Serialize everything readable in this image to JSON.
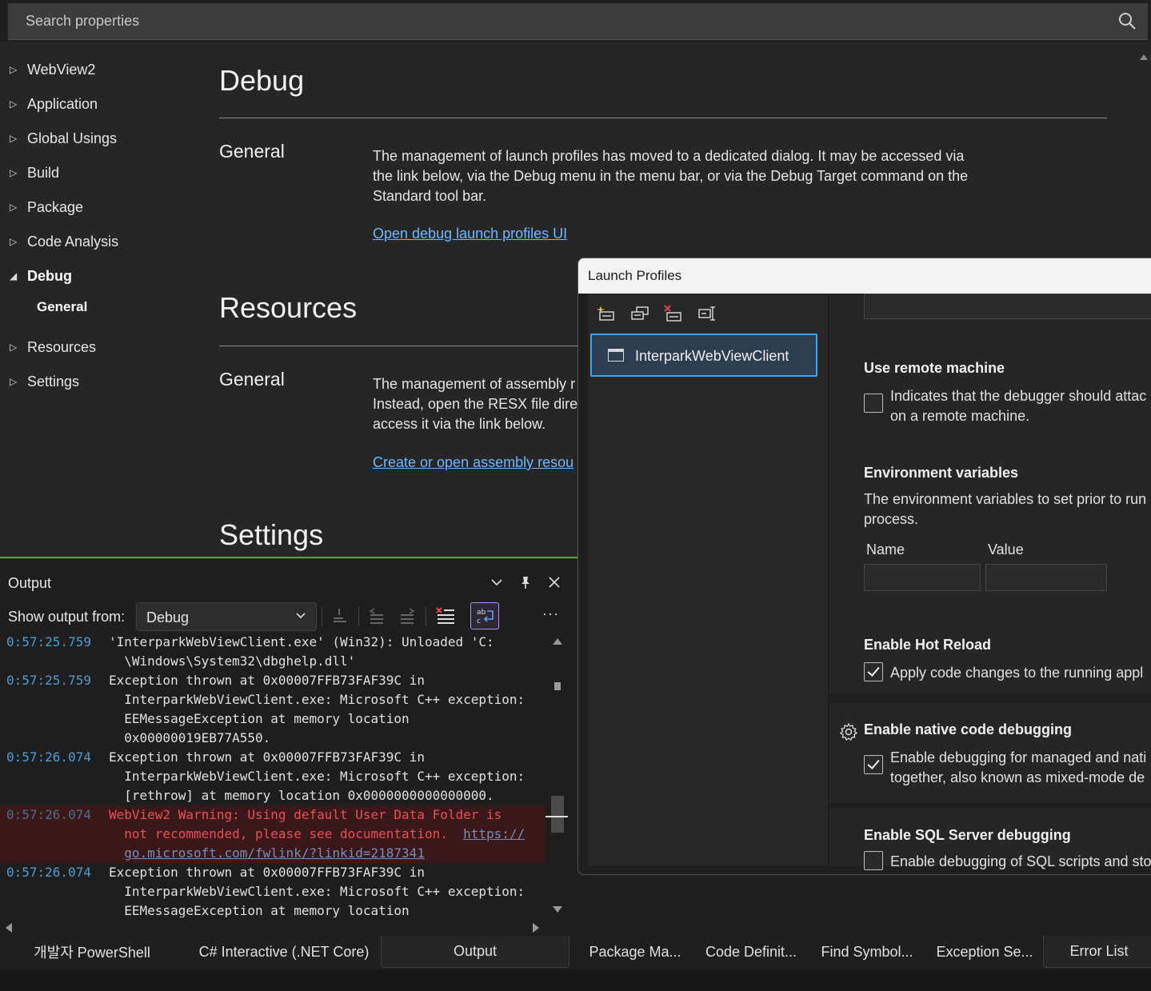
{
  "search": {
    "placeholder": "Search properties"
  },
  "nav": {
    "items": [
      {
        "label": "WebView2",
        "expanded": false
      },
      {
        "label": "Application",
        "expanded": false
      },
      {
        "label": "Global Usings",
        "expanded": false
      },
      {
        "label": "Build",
        "expanded": false
      },
      {
        "label": "Package",
        "expanded": false
      },
      {
        "label": "Code Analysis",
        "expanded": false
      },
      {
        "label": "Debug",
        "expanded": true
      },
      {
        "label": "Resources",
        "expanded": false
      },
      {
        "label": "Settings",
        "expanded": false
      }
    ],
    "debug_sub": "General"
  },
  "content": {
    "debug_title": "Debug",
    "debug_general": "General",
    "debug_desc": "The management of launch profiles has moved to a dedicated dialog. It may be accessed via the link below, via the Debug menu in the menu bar, or via the Debug Target command on the Standard tool bar.",
    "debug_link": "Open debug launch profiles UI",
    "resources_title": "Resources",
    "resources_general": "General",
    "resources_desc_lines": [
      "The management of assembly r",
      "Instead, open the RESX file dire",
      "access it via the link below."
    ],
    "resources_link": "Create or open assembly resou",
    "settings_title": "Settings"
  },
  "output": {
    "title": "Output",
    "show_label": "Show output from:",
    "source": "Debug",
    "more": "···",
    "entries": [
      {
        "ts": "0:57:25.759",
        "lines": [
          "'InterparkWebViewClient.exe' (Win32): Unloaded 'C:",
          "  \\Windows\\System32\\dbghelp.dll'"
        ],
        "warn": false
      },
      {
        "ts": "0:57:25.759",
        "lines": [
          "Exception thrown at 0x00007FFB73FAF39C in",
          "  InterparkWebViewClient.exe: Microsoft C++ exception:",
          "  EEMessageException at memory location",
          "  0x00000019EB77A550."
        ],
        "warn": false
      },
      {
        "ts": "0:57:26.074",
        "lines": [
          "Exception thrown at 0x00007FFB73FAF39C in",
          "  InterparkWebViewClient.exe: Microsoft C++ exception:",
          "  [rethrow] at memory location 0x0000000000000000."
        ],
        "warn": false
      },
      {
        "ts": "0:57:26.074",
        "lines": [
          "WebView2 Warning: Using default User Data Folder is",
          "  not recommended, please see documentation.  "
        ],
        "link1": "https://",
        "link2": "go.microsoft.com/fwlink/?linkid=2187341",
        "warn": true
      },
      {
        "ts": "0:57:26.074",
        "lines": [
          "Exception thrown at 0x00007FFB73FAF39C in",
          "  InterparkWebViewClient.exe: Microsoft C++ exception:",
          "  EEMessageException at memory location"
        ],
        "warn": false
      }
    ]
  },
  "bottom_tabs_left": [
    "개발자 PowerShell",
    "C# Interactive (.NET Core)",
    "Output"
  ],
  "bottom_tabs_left_active": "Output",
  "bottom_tabs_right": [
    "Package Ma...",
    "Code Definit...",
    "Find Symbol...",
    "Exception Se...",
    "Error List"
  ],
  "dialog": {
    "title": "Launch Profiles",
    "profile": "InterparkWebViewClient",
    "remote": {
      "title": "Use remote machine",
      "text_lines": [
        "Indicates that the debugger should attac",
        "on a remote machine."
      ],
      "checked": false
    },
    "env": {
      "title": "Environment variables",
      "text_lines": [
        "The environment variables to set prior to run",
        "process."
      ],
      "name_label": "Name",
      "value_label": "Value"
    },
    "hot_reload": {
      "title": "Enable Hot Reload",
      "text": "Apply code changes to the running appl",
      "checked": true
    },
    "native": {
      "title": "Enable native code debugging",
      "text_lines": [
        "Enable debugging for managed and nati",
        "together, also known as mixed-mode de"
      ],
      "checked": true
    },
    "sql": {
      "title": "Enable SQL Server debugging",
      "text": "Enable debugging of SQL scripts and sto",
      "checked": false
    }
  },
  "colors": {
    "accent_link": "#6fb8ff",
    "selection_border": "#3ea6e8",
    "warning_text": "#e8505a",
    "timestamp": "#4f9bd2",
    "green_line": "#5e9b3a"
  }
}
